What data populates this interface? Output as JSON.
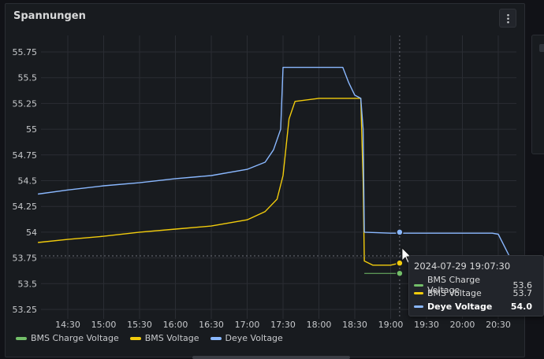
{
  "panel": {
    "title": "Spannungen"
  },
  "menu": {
    "icon": "kebab-icon"
  },
  "chart_data": {
    "type": "line",
    "title": "Spannungen",
    "xlabel": "",
    "ylabel": "",
    "y_ticks": [
      55.75,
      55.5,
      55.25,
      55,
      54.75,
      54.5,
      54.25,
      54,
      53.75,
      53.5,
      53.25
    ],
    "y_tick_labels": [
      "55.75",
      "55.5",
      "55.25",
      "55",
      "54.75",
      "54.5",
      "54.25",
      "54",
      "53.75",
      "53.5",
      "53.25"
    ],
    "x_tick_labels": [
      "14:30",
      "15:00",
      "15:30",
      "16:00",
      "16:30",
      "17:00",
      "17:30",
      "18:00",
      "18:30",
      "19:00",
      "19:30",
      "20:00",
      "20:30"
    ],
    "ylim": [
      53.2,
      55.9
    ],
    "grid": true,
    "legend_position": "bottom-left",
    "series": [
      {
        "name": "BMS Charge Voltage",
        "color": "#73bf69",
        "x": [
          "18:38",
          "18:45",
          "18:55",
          "19:07:30"
        ],
        "y": [
          53.6,
          53.6,
          53.6,
          53.6
        ]
      },
      {
        "name": "BMS Voltage",
        "color": "#f2cc0c",
        "x": [
          "14:05",
          "14:30",
          "15:00",
          "15:30",
          "16:00",
          "16:30",
          "17:00",
          "17:15",
          "17:25",
          "17:30",
          "17:35",
          "17:40",
          "18:00",
          "18:30",
          "18:35",
          "18:37",
          "18:38",
          "18:45",
          "19:00",
          "19:07:30"
        ],
        "y": [
          53.9,
          53.93,
          53.96,
          54.0,
          54.03,
          54.06,
          54.12,
          54.2,
          54.32,
          54.55,
          55.1,
          55.27,
          55.3,
          55.3,
          55.3,
          54.5,
          53.72,
          53.68,
          53.68,
          53.7
        ]
      },
      {
        "name": "Deye Voltage",
        "color": "#8ab8ff",
        "x": [
          "14:05",
          "14:30",
          "15:00",
          "15:30",
          "16:00",
          "16:30",
          "17:00",
          "17:15",
          "17:22",
          "17:28",
          "17:30",
          "17:45",
          "18:00",
          "18:15",
          "18:20",
          "18:25",
          "18:30",
          "18:35",
          "18:37",
          "18:38",
          "19:00",
          "19:30",
          "20:00",
          "20:25",
          "20:30",
          "20:40"
        ],
        "y": [
          54.37,
          54.41,
          54.45,
          54.48,
          54.52,
          54.55,
          54.61,
          54.68,
          54.8,
          55.0,
          55.6,
          55.6,
          55.6,
          55.6,
          55.6,
          55.45,
          55.33,
          55.3,
          55.0,
          54.0,
          53.99,
          53.99,
          53.99,
          53.99,
          53.98,
          53.75
        ]
      }
    ],
    "cursor_time": "19:07:30"
  },
  "legend": [
    {
      "label": "BMS Charge Voltage",
      "color": "#73bf69"
    },
    {
      "label": "BMS Voltage",
      "color": "#f2cc0c"
    },
    {
      "label": "Deye Voltage",
      "color": "#8ab8ff"
    }
  ],
  "tooltip": {
    "time": "2024-07-29 19:07:30",
    "rows": [
      {
        "label": "BMS Charge Voltage",
        "value": "53.6",
        "color": "#73bf69"
      },
      {
        "label": "BMS Voltage",
        "value": "53.7",
        "color": "#f2cc0c"
      },
      {
        "label": "Deye Voltage",
        "value": "54.0",
        "color": "#8ab8ff"
      }
    ]
  }
}
